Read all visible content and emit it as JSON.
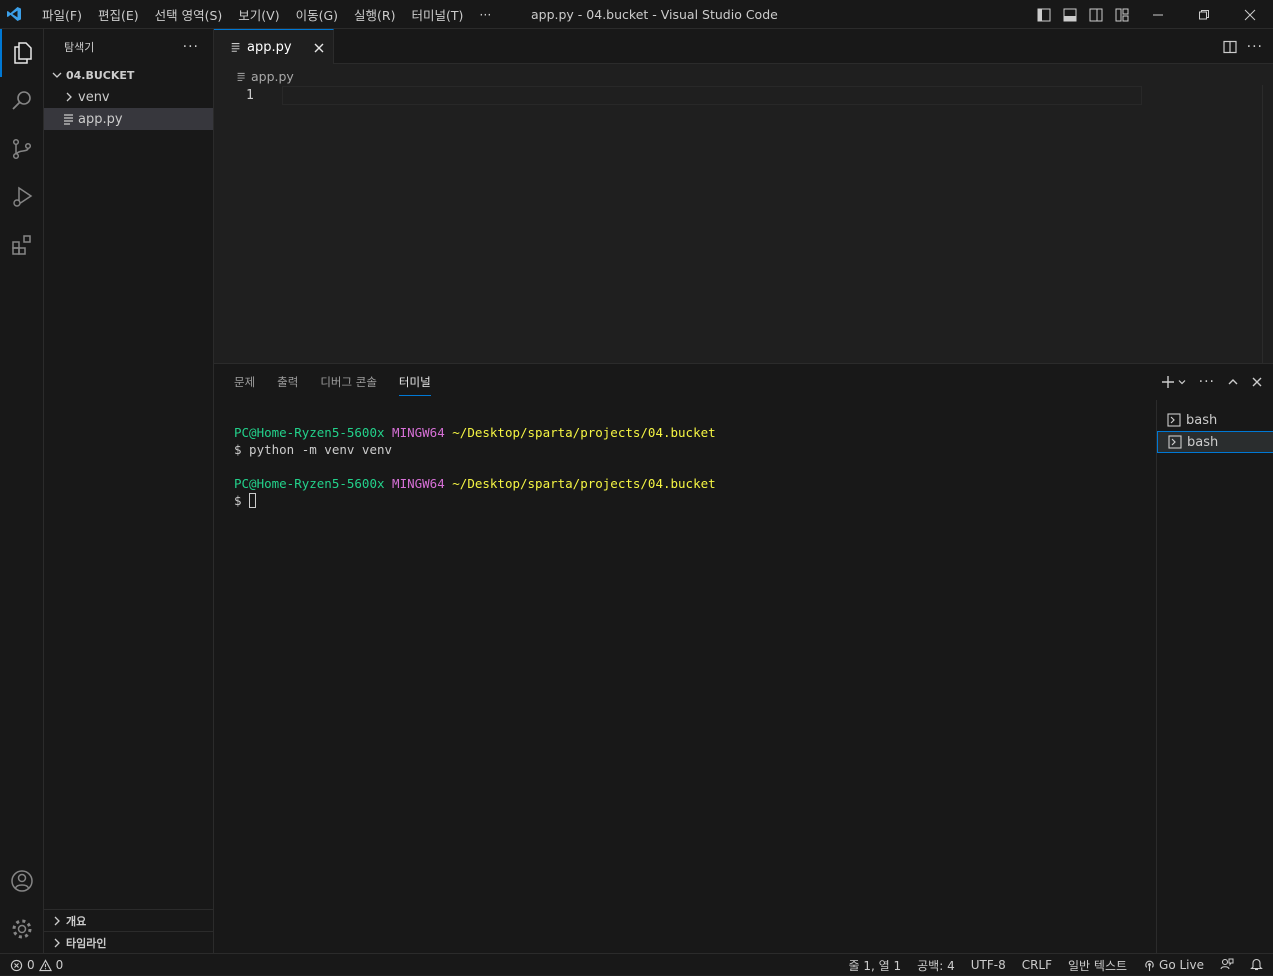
{
  "menu": [
    "파일(F)",
    "편집(E)",
    "선택 영역(S)",
    "보기(V)",
    "이동(G)",
    "실행(R)",
    "터미널(T)",
    "···"
  ],
  "window_title": "app.py - 04.bucket - Visual Studio Code",
  "sidebar": {
    "title": "탐색기",
    "folder": "04.BUCKET",
    "items": [
      {
        "label": "venv",
        "type": "folder"
      },
      {
        "label": "app.py",
        "type": "file"
      }
    ],
    "bottom": [
      "개요",
      "타임라인"
    ]
  },
  "editor": {
    "tab_label": "app.py",
    "breadcrumb": "app.py",
    "line_number": "1"
  },
  "panel": {
    "tabs": [
      "문제",
      "출력",
      "디버그 콘솔",
      "터미널"
    ],
    "active_tab": "터미널",
    "terminal": {
      "prompt_user": "PC@Home-Ryzen5-5600x",
      "prompt_env": "MINGW64",
      "prompt_path": "~/Desktop/sparta/projects/04.bucket",
      "command": "$ python -m venv venv",
      "prompt_symbol": "$"
    },
    "terminal_list": [
      "bash",
      "bash"
    ]
  },
  "statusbar": {
    "errors": "0",
    "warnings": "0",
    "position": "줄 1, 열 1",
    "spaces": "공백: 4",
    "encoding": "UTF-8",
    "eol": "CRLF",
    "language": "일반 텍스트",
    "golive": "Go Live"
  },
  "colors": {
    "accent": "#0078d4",
    "terminal_green": "#23d18b",
    "terminal_magenta": "#d670d6",
    "terminal_yellow": "#f5f543"
  }
}
